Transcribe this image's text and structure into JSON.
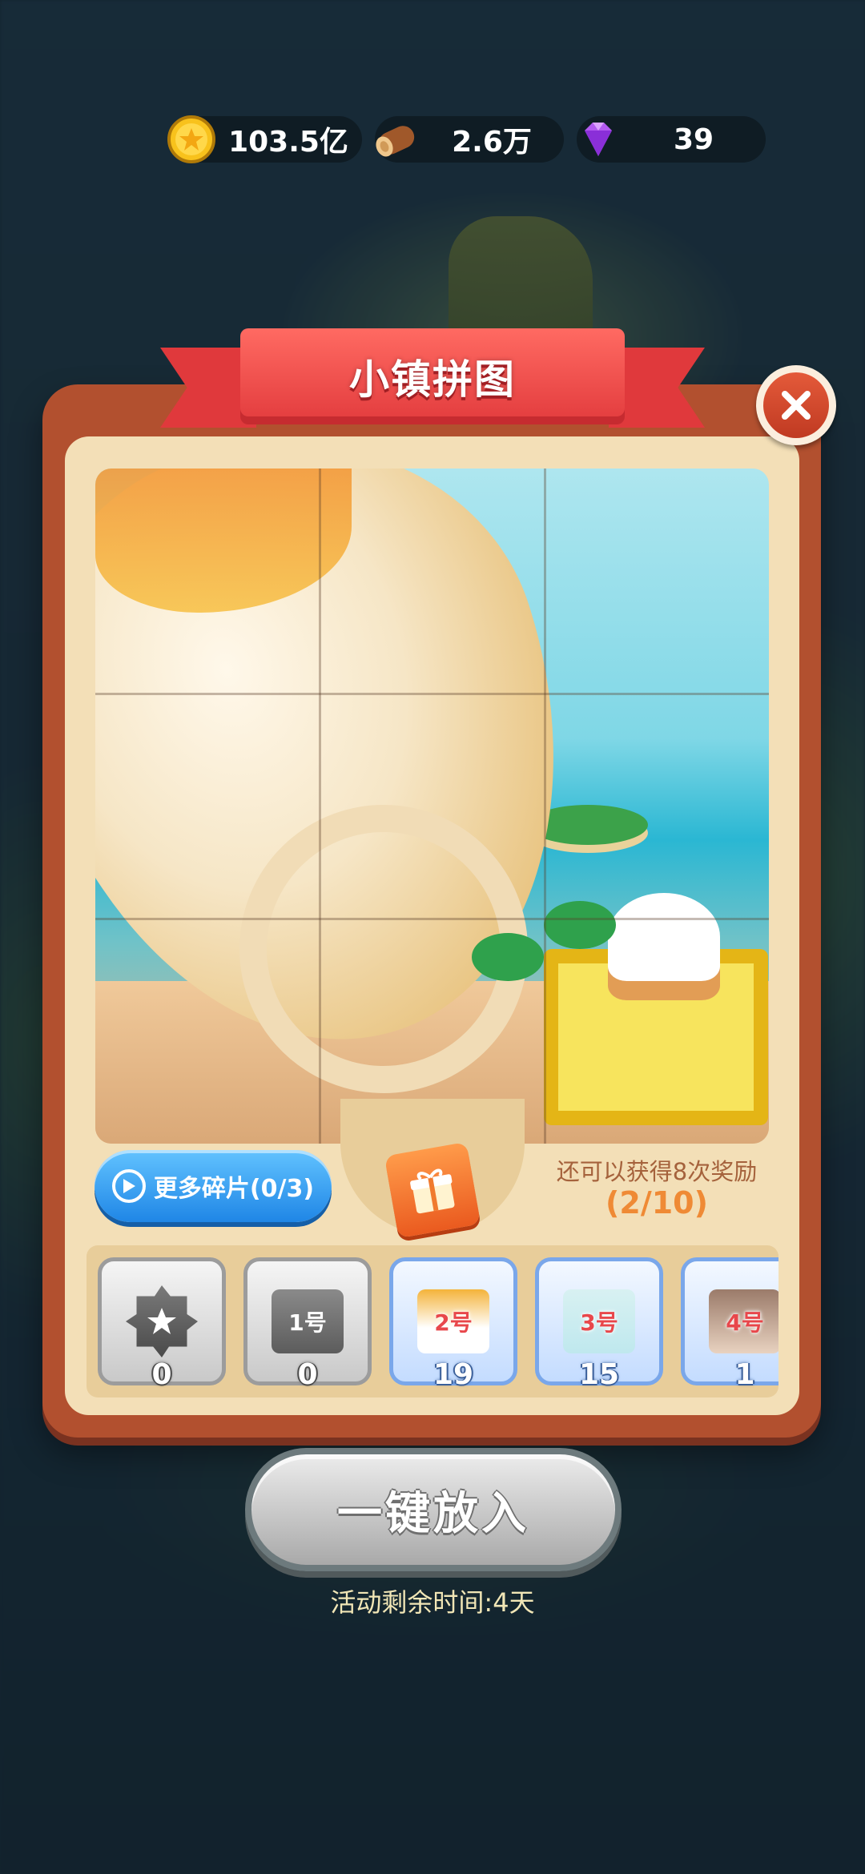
{
  "resources": {
    "gold": "103.5亿",
    "wood": "2.6万",
    "gems": "39"
  },
  "panel": {
    "title": "小镇拼图"
  },
  "controls": {
    "more_pieces_label": "更多碎片(0/3)",
    "reward_text": "还可以获得8次奖励",
    "reward_progress": "(2/10)"
  },
  "tray": {
    "slots": [
      {
        "label": "",
        "count": "0",
        "style": "gray",
        "icon": "star-piece-icon"
      },
      {
        "label": "1号",
        "count": "0",
        "style": "gray"
      },
      {
        "label": "2号",
        "count": "19",
        "style": "blue"
      },
      {
        "label": "3号",
        "count": "15",
        "style": "blue"
      },
      {
        "label": "4号",
        "count": "1",
        "style": "blue"
      }
    ]
  },
  "action": {
    "label": "一键放入"
  },
  "timer": {
    "text": "活动剩余时间:4天"
  },
  "colors": {
    "panel_frame": "#b2502f",
    "panel_inner": "#f3dfb7",
    "ribbon": "#e23b3d",
    "more_button": "#1f86e6",
    "reward_accent": "#ef8a35"
  }
}
